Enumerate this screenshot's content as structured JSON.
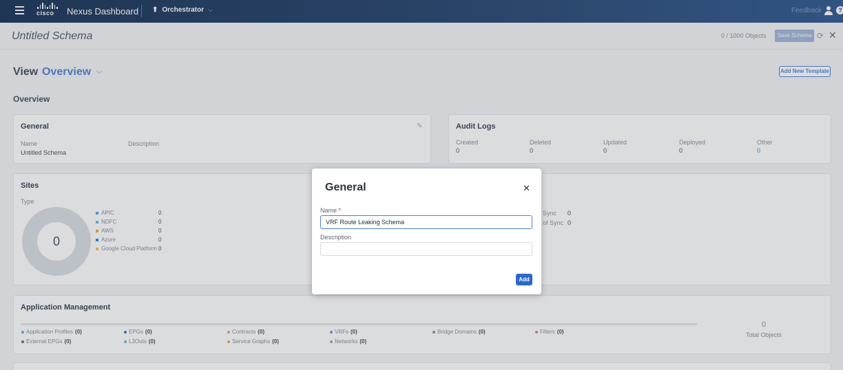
{
  "topbar": {
    "brand": "cisco",
    "product": "Nexus Dashboard",
    "service": "Orchestrator",
    "service_icon": "orchestrator-icon",
    "feedback": "Feedback"
  },
  "schema": {
    "title": "Untitled Schema",
    "object_count": "0 / 1000 Objects",
    "save_label": "Save Schema"
  },
  "view": {
    "label": "View",
    "selected": "Overview",
    "add_template_label": "Add New Template",
    "section_title": "Overview"
  },
  "general_card": {
    "title": "General",
    "name_label": "Name",
    "name_value": "Untitled Schema",
    "description_label": "Description"
  },
  "audit_card": {
    "title": "Audit Logs",
    "columns": [
      {
        "label": "Created",
        "value": "0"
      },
      {
        "label": "Deleted",
        "value": "0"
      },
      {
        "label": "Updated",
        "value": "0"
      },
      {
        "label": "Deployed",
        "value": "0"
      },
      {
        "label": "Other",
        "value": "0"
      }
    ]
  },
  "sites_card": {
    "title": "Sites",
    "type_label": "Type",
    "total": "0",
    "legend": [
      {
        "name": "APIC",
        "count": "0",
        "color": "#5a9fe0"
      },
      {
        "name": "NDFC",
        "count": "0",
        "color": "#58c1d6"
      },
      {
        "name": "AWS",
        "count": "0",
        "color": "#f3a33b"
      },
      {
        "name": "Azure",
        "count": "0",
        "color": "#2f7ed8"
      },
      {
        "name": "Google Cloud Platform",
        "count": "0",
        "color": "#f6c343"
      }
    ]
  },
  "sync_card": {
    "rows": [
      {
        "label": "Sync",
        "value": "0"
      },
      {
        "label": "of Sync",
        "value": "0"
      }
    ]
  },
  "app_mgmt": {
    "title": "Application Management",
    "items": [
      {
        "label": "Application Profiles",
        "count": "(0)",
        "color": "#5a9fe0"
      },
      {
        "label": "EPGs",
        "count": "(0)",
        "color": "#3b6fc2"
      },
      {
        "label": "Contracts",
        "count": "(0)",
        "color": "#f3a33b"
      },
      {
        "label": "VRFs",
        "count": "(0)",
        "color": "#9d7ad6"
      },
      {
        "label": "Bridge Domains",
        "count": "(0)",
        "color": "#7f8a96"
      },
      {
        "label": "Filters",
        "count": "(0)",
        "color": "#e07a9b"
      },
      {
        "label": "External EPGs",
        "count": "(0)",
        "color": "#5a6572"
      },
      {
        "label": "L3Outs",
        "count": "(0)",
        "color": "#58c1d6"
      },
      {
        "label": "Service Graphs",
        "count": "(0)",
        "color": "#f3a33b"
      },
      {
        "label": "Networks",
        "count": "(0)",
        "color": "#9aa4b0"
      }
    ],
    "total_value": "0",
    "total_label": "Total Objects"
  },
  "modal": {
    "title": "General",
    "name_label": "Name",
    "required_mark": "*",
    "name_value": "VRF Route Leaking Schema",
    "description_label": "Description",
    "description_value": "",
    "add_label": "Add"
  }
}
